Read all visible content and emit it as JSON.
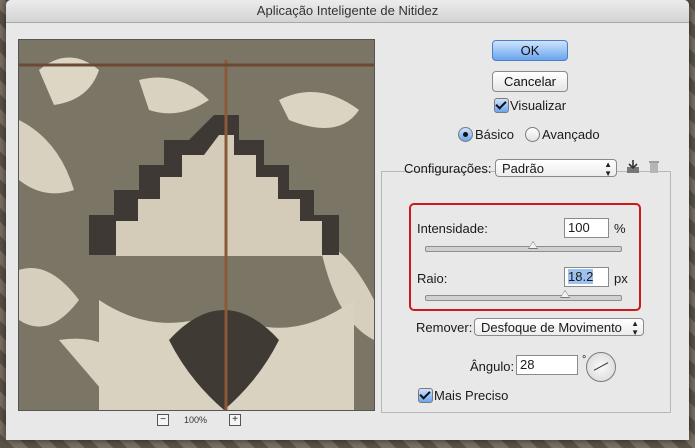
{
  "window": {
    "title": "Aplicação Inteligente de Nitidez"
  },
  "buttons": {
    "ok": "OK",
    "cancel": "Cancelar"
  },
  "preview_toggle": {
    "label": "Visualizar",
    "checked": true
  },
  "mode": {
    "basic": "Básico",
    "advanced": "Avançado",
    "selected": "basic"
  },
  "settings": {
    "label": "Configurações:",
    "value": "Padrão"
  },
  "amount": {
    "label": "Intensidade:",
    "value": "100",
    "unit": "%",
    "slider_fraction": 0.5
  },
  "radius": {
    "label": "Raio:",
    "value": "18.2",
    "unit": "px",
    "slider_fraction": 0.72
  },
  "remove": {
    "label": "Remover:",
    "value": "Desfoque de Movimento"
  },
  "angle": {
    "label": "Ângulo:",
    "value": "28",
    "unit": "°"
  },
  "more_accurate": {
    "label": "Mais Preciso",
    "checked": true
  },
  "zoom": {
    "level": "100%",
    "minus": "−",
    "plus": "+"
  },
  "icons": {
    "save": "save-preset-icon",
    "delete": "trash-icon",
    "dial": "angle-dial-icon"
  }
}
